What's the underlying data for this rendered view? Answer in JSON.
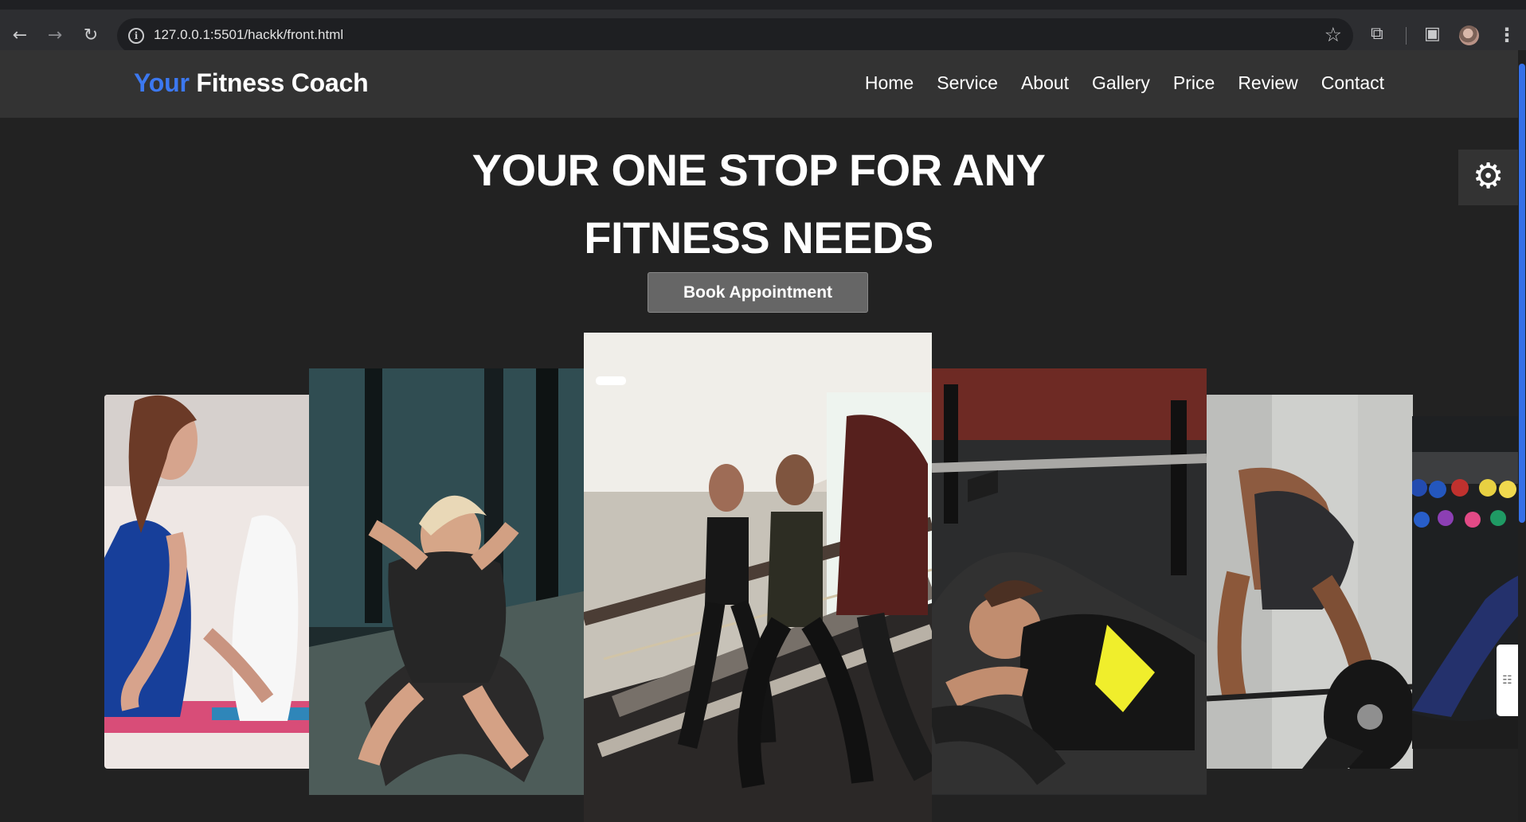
{
  "browser": {
    "url": "127.0.0.1:5501/hackk/front.html",
    "icons": [
      "back-arrow-icon",
      "forward-arrow-icon",
      "reload-icon",
      "info-icon",
      "star-icon",
      "extensions-icon",
      "sidebar-icon",
      "profile-avatar",
      "menu-kebab-icon"
    ]
  },
  "header": {
    "logo_accent": "Your",
    "logo_rest": " Fitness Coach",
    "nav": [
      "Home",
      "Service",
      "About",
      "Gallery",
      "Price",
      "Review",
      "Contact"
    ]
  },
  "hero": {
    "title": "YOUR ONE STOP FOR ANY FITNESS NEEDS",
    "button": "Book Appointment"
  },
  "gallery": {
    "images": [
      "yoga",
      "situps",
      "treadmill running",
      "bench press",
      "deadlift",
      "stretching"
    ]
  },
  "colors": {
    "accent": "#3c78f0",
    "background": "#222222",
    "header": "#333333",
    "button": "#666666"
  }
}
